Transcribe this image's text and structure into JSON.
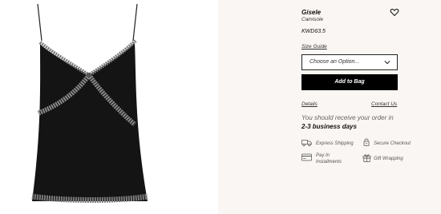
{
  "product": {
    "name": "Gisele",
    "type": "Camisole",
    "price": "KWD63.5"
  },
  "size_guide_label": "Size Guide",
  "option_select": {
    "selected": "Choose an Option..."
  },
  "add_to_bag_label": "Add to Bag",
  "links": {
    "details": "Details",
    "contact": "Contact Us"
  },
  "delivery": {
    "line1": "You should receive your order in",
    "line2": "2-3 business days"
  },
  "features": {
    "express_shipping": "Express Shipping",
    "secure_checkout": "Secure Checkout",
    "pay_line1": "Pay In",
    "pay_line2": "Installments",
    "gift_wrapping": "Gift Wrapping"
  },
  "icons": {
    "wishlist": "heart-icon",
    "dropdown": "chevron-down-icon",
    "shipping": "truck-icon",
    "checkout": "lock-icon",
    "installments": "credit-card-icon",
    "gift": "gift-icon"
  },
  "colors": {
    "product_panel_bg": "#faf6f3",
    "button_bg": "#000000",
    "button_text": "#ffffff"
  }
}
